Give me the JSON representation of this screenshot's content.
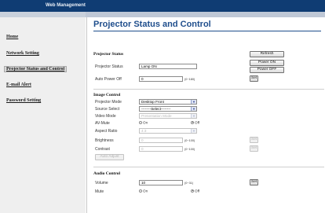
{
  "app": {
    "title": "Web Management"
  },
  "sidebar": {
    "items": [
      {
        "label": "Home"
      },
      {
        "label": "Network Setting"
      },
      {
        "label": "Projector Status and Control"
      },
      {
        "label": "E-mail Alert"
      },
      {
        "label": "Password Setting"
      }
    ]
  },
  "main": {
    "title": "Projector Status and Control",
    "status_section": {
      "title": "Projector Status",
      "refresh_label": "Refresh",
      "projector_status_label": "Projector Status",
      "projector_status_value": "Lamp ON",
      "power_on_label": "Power ON",
      "power_off_label": "Power OFF",
      "auto_power_off_label": "Auto Power Off",
      "auto_power_off_value": "0",
      "auto_power_off_range": "(0~180)",
      "set_label": "Set"
    },
    "image_section": {
      "title": "Image Control",
      "projector_mode_label": "Projector Mode",
      "projector_mode_value": "Desktop Front",
      "source_select_label": "Source Select",
      "source_select_value": "--------Select--------",
      "video_mode_label": "Video Mode",
      "video_mode_value": "Presentation Mode",
      "av_mute_label": "AV-Mute",
      "av_mute_on": "On",
      "av_mute_off": "Off",
      "aspect_ratio_label": "Aspect Ratio",
      "aspect_ratio_value": "4:3",
      "brightness_label": "Brightness",
      "brightness_value": "0",
      "brightness_range": "(0~100)",
      "contrast_label": "Contrast",
      "contrast_value": "0",
      "contrast_range": "(0~100)",
      "set_label": "Set",
      "auto_adjust_label": "Auto Adjust"
    },
    "audio_section": {
      "title": "Audio Control",
      "volume_label": "Volume",
      "volume_value": "10",
      "volume_range": "(0~31)",
      "set_label": "Set",
      "mute_label": "Mute",
      "mute_on": "On",
      "mute_off": "Off"
    }
  }
}
